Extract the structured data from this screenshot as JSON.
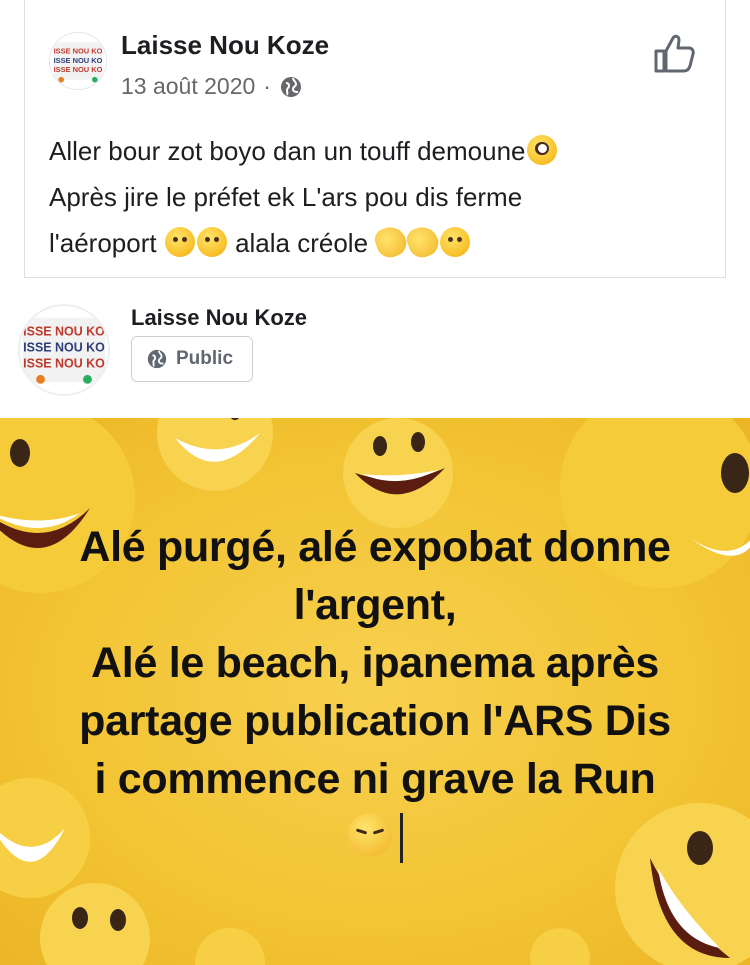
{
  "post": {
    "author": "Laisse Nou Koze",
    "date": "13 août 2020",
    "separator": "·",
    "visibility_icon": "globe-icon",
    "like_icon": "thumbs-up-icon",
    "lines": [
      "Aller bour zot boyo dan un touff demoune",
      "Après jire le préfet ek L'ars pou dis ferme",
      "l'aéroport",
      "alala créole"
    ]
  },
  "shared": {
    "author": "Laisse Nou Koze",
    "audience": "Public",
    "audience_icon": "globe-icon"
  },
  "avatar": {
    "text_lines": [
      "ISSE NOU KO",
      "ISSE NOU KO",
      "ISSE NOU KO"
    ]
  },
  "meme": {
    "lines": [
      "Alé purgé, alé expobat donne",
      "l'argent,",
      "Alé le beach, ipanema après",
      "partage publication l'ARS Dis",
      "i commence ni grave la Run"
    ],
    "emoji": "pensive-face-icon"
  },
  "colors": {
    "text": "#1c1e21",
    "secondary": "#65676b",
    "meme_bg": "#f3c433",
    "border": "#dddfe2"
  }
}
